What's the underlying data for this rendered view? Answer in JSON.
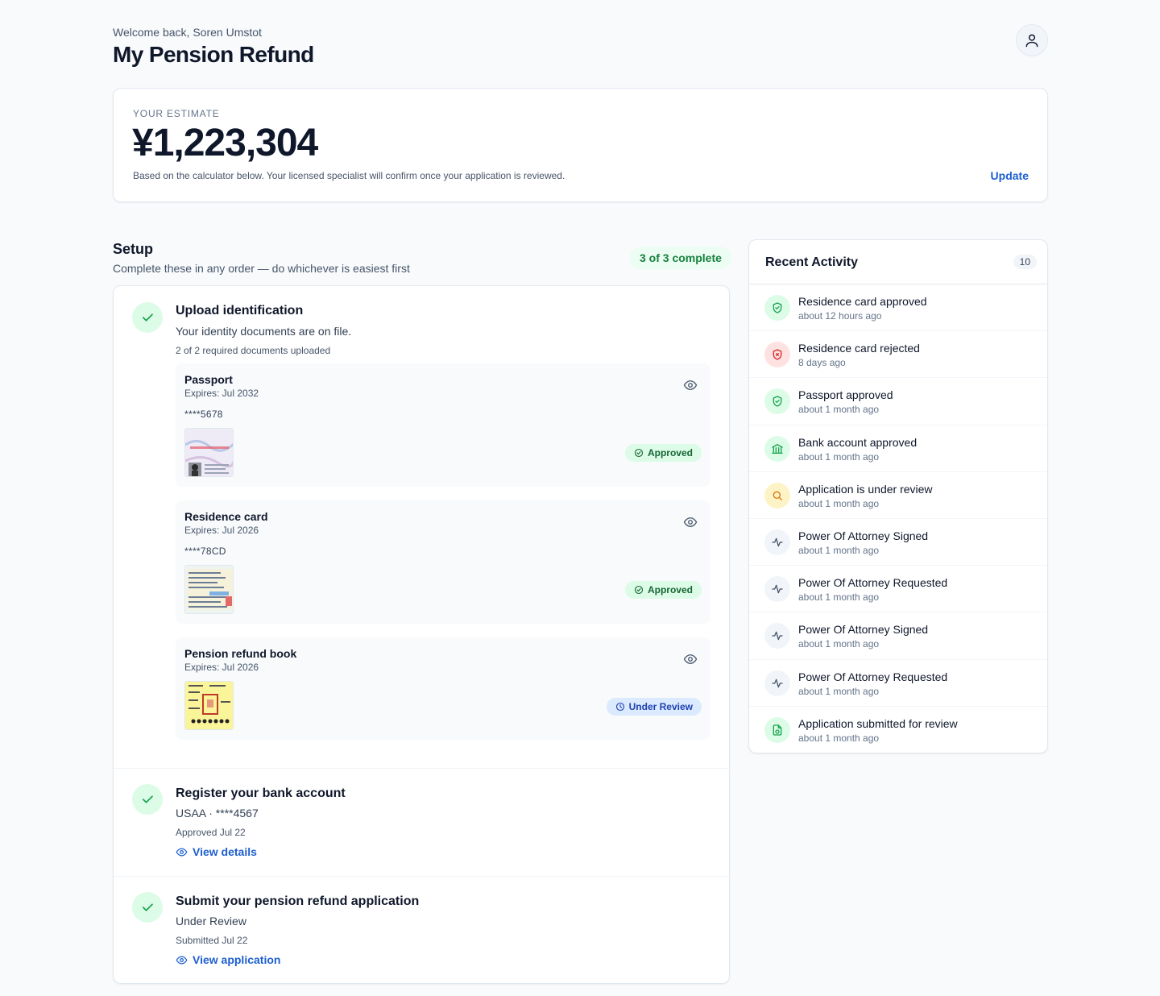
{
  "header": {
    "welcome": "Welcome back, Soren Umstot",
    "title": "My Pension Refund"
  },
  "estimate": {
    "label": "YOUR ESTIMATE",
    "amount": "¥1,223,304",
    "note": "Based on the calculator below. Your licensed specialist will confirm once your application is reviewed.",
    "update_label": "Update"
  },
  "setup": {
    "title": "Setup",
    "subtitle": "Complete these in any order — do whichever is easiest first",
    "complete_badge": "3 of 3 complete",
    "step1": {
      "title": "Upload identification",
      "desc": "Your identity documents are on file.",
      "meta": "2 of 2 required documents uploaded",
      "docs": [
        {
          "name": "Passport",
          "expires": "Expires: Jul 2032",
          "number": "****5678",
          "status": "Approved"
        },
        {
          "name": "Residence card",
          "expires": "Expires: Jul 2026",
          "number": "****78CD",
          "status": "Approved"
        },
        {
          "name": "Pension refund book",
          "expires": "Expires: Jul 2026",
          "status": "Under Review"
        }
      ]
    },
    "step2": {
      "title": "Register your bank account",
      "desc": "USAA · ****4567",
      "meta": "Approved Jul 22",
      "link": "View details"
    },
    "step3": {
      "title": "Submit your pension refund application",
      "desc": "Under Review",
      "meta": "Submitted Jul 22",
      "link": "View application"
    }
  },
  "activity": {
    "title": "Recent Activity",
    "count": "10",
    "items": [
      {
        "text": "Residence card approved",
        "time": "about 12 hours ago",
        "icon": "shield-check-icon",
        "tone": "green"
      },
      {
        "text": "Residence card rejected",
        "time": "8 days ago",
        "icon": "shield-x-icon",
        "tone": "red"
      },
      {
        "text": "Passport approved",
        "time": "about 1 month ago",
        "icon": "shield-check-icon",
        "tone": "green"
      },
      {
        "text": "Bank account approved",
        "time": "about 1 month ago",
        "icon": "bank-icon",
        "tone": "green"
      },
      {
        "text": "Application is under review",
        "time": "about 1 month ago",
        "icon": "search-icon",
        "tone": "amber"
      },
      {
        "text": "Power Of Attorney Signed",
        "time": "about 1 month ago",
        "icon": "activity-icon",
        "tone": "gray"
      },
      {
        "text": "Power Of Attorney Requested",
        "time": "about 1 month ago",
        "icon": "activity-icon",
        "tone": "gray"
      },
      {
        "text": "Power Of Attorney Signed",
        "time": "about 1 month ago",
        "icon": "activity-icon",
        "tone": "gray"
      },
      {
        "text": "Power Of Attorney Requested",
        "time": "about 1 month ago",
        "icon": "activity-icon",
        "tone": "gray"
      },
      {
        "text": "Application submitted for review",
        "time": "about 1 month ago",
        "icon": "file-check-icon",
        "tone": "green"
      }
    ]
  },
  "colors": {
    "accent": "#1d5fd1",
    "success": "#15803d",
    "success_bg": "#dcfce7",
    "danger": "#dc2626",
    "warning": "#d97706"
  }
}
